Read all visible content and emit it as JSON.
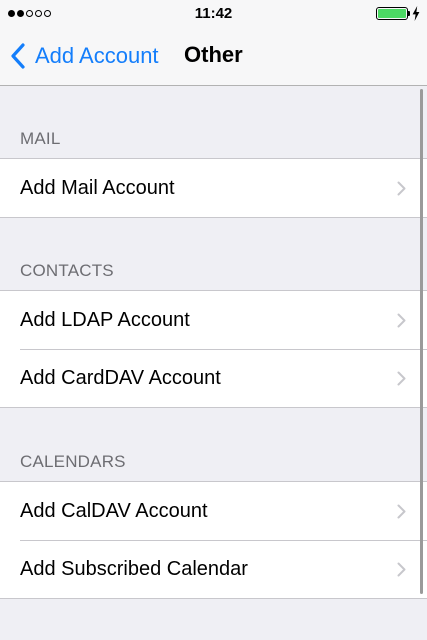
{
  "status_bar": {
    "time": "11:42",
    "signal_strength": 2,
    "signal_max": 5,
    "battery_level": 1.0,
    "battery_color": "#4cd964"
  },
  "nav": {
    "back_label": "Add Account",
    "title": "Other",
    "accent_color": "#147efb"
  },
  "sections": [
    {
      "header": "MAIL",
      "items": [
        {
          "label": "Add Mail Account"
        }
      ]
    },
    {
      "header": "CONTACTS",
      "items": [
        {
          "label": "Add LDAP Account"
        },
        {
          "label": "Add CardDAV Account"
        }
      ]
    },
    {
      "header": "CALENDARS",
      "items": [
        {
          "label": "Add CalDAV Account"
        },
        {
          "label": "Add Subscribed Calendar"
        }
      ]
    }
  ],
  "icons": {
    "back": "chevron-left-icon",
    "disclosure": "chevron-right-icon",
    "charging": "bolt-icon"
  }
}
